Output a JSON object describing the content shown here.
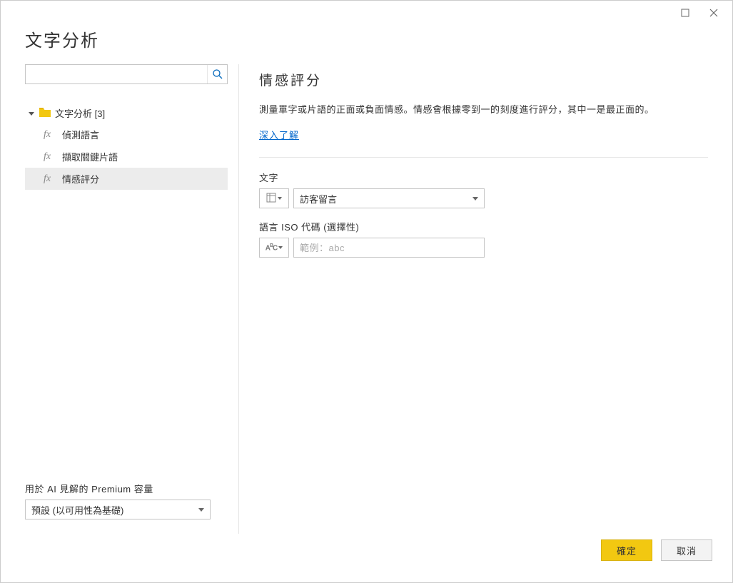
{
  "dialog": {
    "title": "文字分析"
  },
  "sidebar": {
    "search_placeholder": "",
    "group_label": "文字分析 [3]",
    "items": [
      {
        "label": "偵測語言"
      },
      {
        "label": "擷取關鍵片語"
      },
      {
        "label": "情感評分"
      }
    ],
    "premium_label": "用於 AI 見解的 Premium 容量",
    "premium_value": "預設 (以可用性為基礎)"
  },
  "main": {
    "title": "情感評分",
    "description": "測量單字或片語的正面或負面情感。情感會根據零到一的刻度進行評分，其中一是最正面的。",
    "learn_more": "深入了解",
    "fields": {
      "text_label": "文字",
      "text_value": "訪客留言",
      "lang_label": "語言 ISO 代碼 (選擇性)",
      "lang_placeholder": "範例：abc"
    }
  },
  "footer": {
    "ok": "確定",
    "cancel": "取消"
  }
}
